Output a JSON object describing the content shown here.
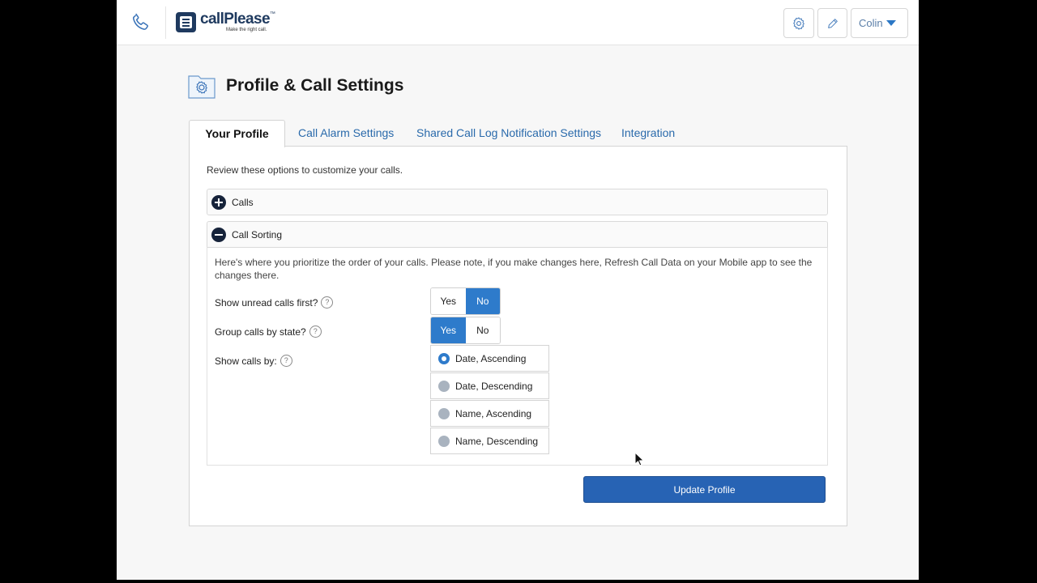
{
  "app": {
    "logo_name": "callPlease",
    "logo_tm": "™",
    "logo_tagline": "Make the right call.",
    "user_name": "Colin"
  },
  "page": {
    "title": "Profile & Call Settings"
  },
  "tabs": [
    {
      "label": "Your Profile",
      "active": true
    },
    {
      "label": "Call Alarm Settings",
      "active": false
    },
    {
      "label": "Shared Call Log Notification Settings",
      "active": false
    },
    {
      "label": "Integration",
      "active": false
    }
  ],
  "panel": {
    "intro": "Review these options to customize your calls.",
    "accordions": [
      {
        "label": "Calls",
        "expanded": false
      },
      {
        "label": "Call Sorting",
        "expanded": true
      }
    ],
    "sorting": {
      "description": "Here's where you prioritize the order of your calls. Please note, if you make changes here, Refresh Call Data on your Mobile app to see the changes there.",
      "unread_first": {
        "label": "Show unread calls first?",
        "yes": "Yes",
        "no": "No",
        "selected": "No"
      },
      "group_state": {
        "label": "Group calls by state?",
        "yes": "Yes",
        "no": "No",
        "selected": "Yes"
      },
      "show_by": {
        "label": "Show calls by:",
        "options": [
          "Date, Ascending",
          "Date, Descending",
          "Name, Ascending",
          "Name, Descending"
        ],
        "selected": "Date, Ascending"
      },
      "help_glyph": "?"
    },
    "update_button": "Update Profile"
  },
  "colors": {
    "accent": "#2e7bcb",
    "primary_button": "#2763b4",
    "link": "#2a6aab",
    "dark_icon": "#16233a"
  },
  "icons": {
    "phone": "phone-icon",
    "logo": "logo-icon",
    "settings": "gear-icon",
    "edit": "pencil-icon",
    "user_menu": "caret-down-icon",
    "page": "settings-folder-icon",
    "expand": "plus-circle-icon",
    "collapse": "minus-circle-icon",
    "help": "help-icon"
  }
}
